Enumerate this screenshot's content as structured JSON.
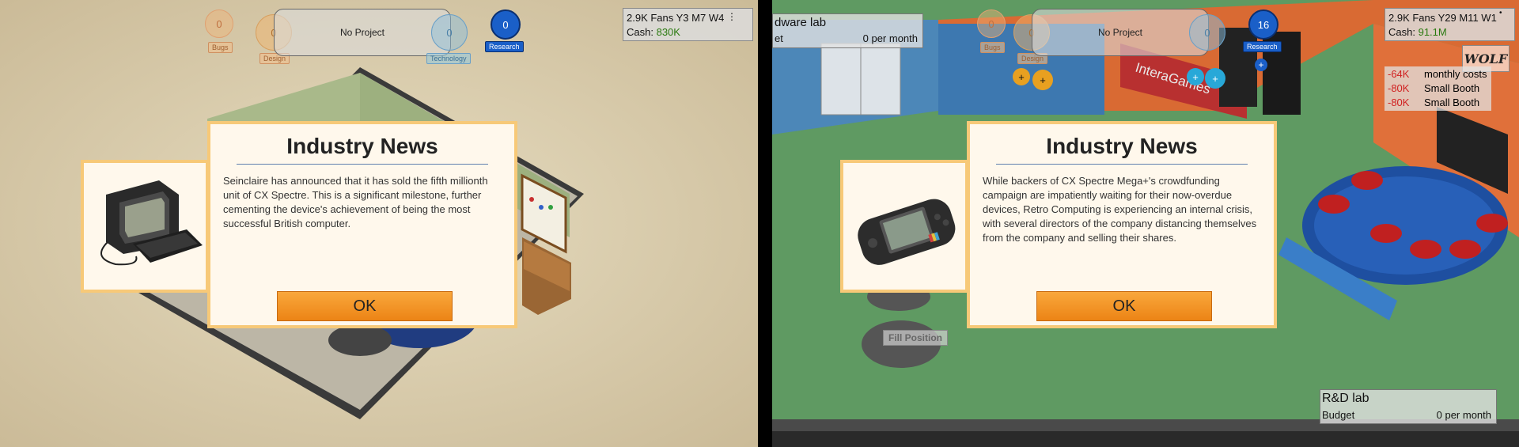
{
  "left": {
    "hud": {
      "bugs": {
        "value": "0",
        "label": "Bugs"
      },
      "design": {
        "value": "0",
        "label": "Design"
      },
      "technology": {
        "value": "0",
        "label": "Technology"
      },
      "research": {
        "value": "0",
        "label": "Research"
      },
      "project_label": "No Project"
    },
    "stats": {
      "line1": "2.9K Fans Y3 M7 W4",
      "cash_label": "Cash:",
      "cash_value": "830K"
    },
    "news": {
      "title": "Industry News",
      "body": "Seinclaire has announced that it has sold the fifth millionth unit of CX Spectre. This is a significant milestone, further cementing the device's achievement of being the most successful British computer.",
      "ok": "OK",
      "image_icon": "retro-computer-icon"
    }
  },
  "right": {
    "hud": {
      "bugs": {
        "value": "0",
        "label": "Bugs"
      },
      "design": {
        "value": "0",
        "label": "Design"
      },
      "technology": {
        "value": "0",
        "label": "Technology"
      },
      "research": {
        "value": "16",
        "label": "Research"
      },
      "project_label": "No Project"
    },
    "stats": {
      "line1": "2.9K Fans Y29 M11 W1",
      "cash_label": "Cash:",
      "cash_value": "91.1M"
    },
    "expenses": [
      {
        "amount": "-64K",
        "label": "monthly costs"
      },
      {
        "amount": "-80K",
        "label": "Small Booth"
      },
      {
        "amount": "-80K",
        "label": "Small Booth"
      }
    ],
    "hardware_lab": {
      "title": "dware lab",
      "budget_label": "et",
      "budget_value": "0 per month"
    },
    "rd_lab": {
      "title": "R&D lab",
      "budget_label": "Budget",
      "budget_value": "0 per month"
    },
    "company_sign": "InteraGames",
    "fill_position": "Fill Position",
    "logo_text": "WOLF",
    "news": {
      "title": "Industry News",
      "body": "While backers of CX Spectre Mega+'s crowdfunding campaign are impatiently waiting for their now-overdue devices, Retro Computing is experiencing an internal crisis, with several directors of the company distancing themselves from the company and selling their shares.",
      "ok": "OK",
      "image_icon": "handheld-console-icon"
    }
  },
  "colors": {
    "accent_orange": "#ec8415",
    "research_blue": "#1a5fc8",
    "cash_green": "#2a7a10",
    "expense_red": "#d02020"
  }
}
